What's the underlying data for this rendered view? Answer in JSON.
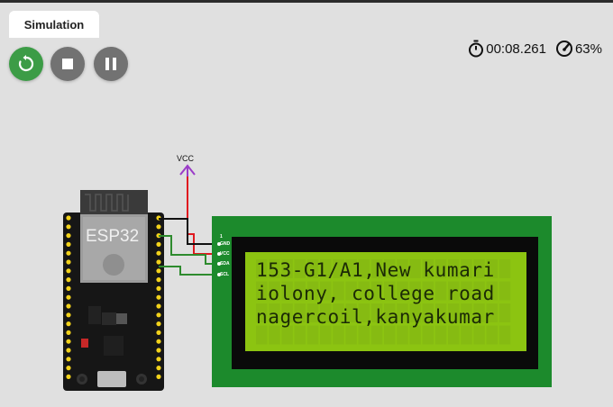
{
  "tab": {
    "label": "Simulation"
  },
  "controls": {
    "restart": "restart-icon",
    "stop": "stop-icon",
    "pause": "pause-icon"
  },
  "status": {
    "timer": "00:08.261",
    "speed": "63%"
  },
  "circuit": {
    "vcc_label": "VCC",
    "esp_label": "ESP32",
    "lcd_pins": {
      "pin1": "1",
      "gnd": "GND",
      "vcc": "VCC",
      "sda": "SDA",
      "scl": "SCL"
    },
    "lcd_lines": [
      "153-G1/A1,New kumari",
      "iolony, college road",
      "nagercoil,kanyakumar"
    ]
  },
  "colors": {
    "restart": "#3c9c46",
    "gray_button": "#727272",
    "lcd_bezel": "#1c8a2c",
    "lcd_screen": "#8cc411",
    "wire_red": "#e0191f",
    "wire_green": "#2e8b2e",
    "vcc_arrow": "#9b3cc8"
  }
}
